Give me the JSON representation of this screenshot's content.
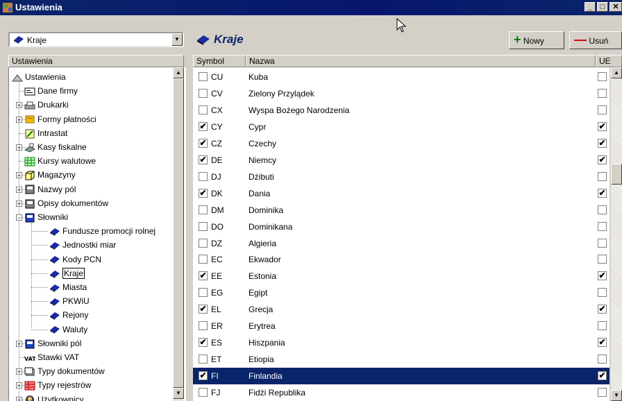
{
  "window": {
    "title": "Ustawienia",
    "controls": [
      "minimize",
      "maximize",
      "close"
    ]
  },
  "left": {
    "combo_value": "Kraje",
    "header": "Ustawienia",
    "tree": [
      {
        "label": "Ustawienia",
        "level": 0,
        "icon": "settings-icon",
        "expander": ""
      },
      {
        "label": "Dane firmy",
        "level": 1,
        "icon": "company-card-icon",
        "expander": ""
      },
      {
        "label": "Drukarki",
        "level": 1,
        "icon": "printer-icon",
        "expander": "+"
      },
      {
        "label": "Formy płatności",
        "level": 1,
        "icon": "payment-icon",
        "expander": "+"
      },
      {
        "label": "Intrastat",
        "level": 1,
        "icon": "intrastat-icon",
        "expander": ""
      },
      {
        "label": "Kasy fiskalne",
        "level": 1,
        "icon": "cash-register-icon",
        "expander": "+"
      },
      {
        "label": "Kursy walutowe",
        "level": 1,
        "icon": "currency-table-icon",
        "expander": ""
      },
      {
        "label": "Magazyny",
        "level": 1,
        "icon": "warehouse-icon",
        "expander": "+"
      },
      {
        "label": "Nazwy pól",
        "level": 1,
        "icon": "field-names-icon",
        "expander": "+"
      },
      {
        "label": "Opisy dokumentów",
        "level": 1,
        "icon": "document-desc-icon",
        "expander": "+"
      },
      {
        "label": "Słowniki",
        "level": 1,
        "icon": "dictionary-icon",
        "expander": "−"
      },
      {
        "label": "Fundusze promocji rolnej",
        "level": 2,
        "icon": "book-icon",
        "expander": ""
      },
      {
        "label": "Jednostki miar",
        "level": 2,
        "icon": "book-icon",
        "expander": ""
      },
      {
        "label": "Kody PCN",
        "level": 2,
        "icon": "book-icon",
        "expander": ""
      },
      {
        "label": "Kraje",
        "level": 2,
        "icon": "book-icon",
        "expander": "",
        "selected": true
      },
      {
        "label": "Miasta",
        "level": 2,
        "icon": "book-icon",
        "expander": ""
      },
      {
        "label": "PKWiU",
        "level": 2,
        "icon": "book-icon",
        "expander": ""
      },
      {
        "label": "Rejony",
        "level": 2,
        "icon": "book-icon",
        "expander": ""
      },
      {
        "label": "Waluty",
        "level": 2,
        "icon": "book-icon",
        "expander": ""
      },
      {
        "label": "Słowniki pól",
        "level": 1,
        "icon": "dictionary-icon",
        "expander": "+"
      },
      {
        "label": "Stawki VAT",
        "level": 1,
        "icon": "vat-icon",
        "expander": ""
      },
      {
        "label": "Typy dokumentów",
        "level": 1,
        "icon": "document-types-icon",
        "expander": "+"
      },
      {
        "label": "Typy rejestrów",
        "level": 1,
        "icon": "register-types-icon",
        "expander": "+"
      },
      {
        "label": "Użytkownicy",
        "level": 1,
        "icon": "users-icon",
        "expander": "+"
      }
    ]
  },
  "right": {
    "title": "Kraje",
    "new_label": "Nowy",
    "delete_label": "Usuń",
    "columns": {
      "symbol": "Symbol",
      "name": "Nazwa",
      "eu": "UE"
    },
    "rows": [
      {
        "sym": "CU",
        "name": "Kuba",
        "checked": false,
        "eu": false
      },
      {
        "sym": "CV",
        "name": "Zielony Przylądek",
        "checked": false,
        "eu": false
      },
      {
        "sym": "CX",
        "name": "Wyspa Bożego Narodzenia",
        "checked": false,
        "eu": false
      },
      {
        "sym": "CY",
        "name": "Cypr",
        "checked": true,
        "eu": true
      },
      {
        "sym": "CZ",
        "name": "Czechy",
        "checked": true,
        "eu": true
      },
      {
        "sym": "DE",
        "name": "Niemcy",
        "checked": true,
        "eu": true
      },
      {
        "sym": "DJ",
        "name": "Dżibuti",
        "checked": false,
        "eu": false
      },
      {
        "sym": "DK",
        "name": "Dania",
        "checked": true,
        "eu": true
      },
      {
        "sym": "DM",
        "name": "Dominika",
        "checked": false,
        "eu": false
      },
      {
        "sym": "DO",
        "name": "Dominikana",
        "checked": false,
        "eu": false
      },
      {
        "sym": "DZ",
        "name": "Algieria",
        "checked": false,
        "eu": false
      },
      {
        "sym": "EC",
        "name": "Ekwador",
        "checked": false,
        "eu": false
      },
      {
        "sym": "EE",
        "name": "Estonia",
        "checked": true,
        "eu": true
      },
      {
        "sym": "EG",
        "name": "Egipt",
        "checked": false,
        "eu": false
      },
      {
        "sym": "EL",
        "name": "Grecja",
        "checked": true,
        "eu": true
      },
      {
        "sym": "ER",
        "name": "Erytrea",
        "checked": false,
        "eu": false
      },
      {
        "sym": "ES",
        "name": "Hiszpania",
        "checked": true,
        "eu": true
      },
      {
        "sym": "ET",
        "name": "Etiopia",
        "checked": false,
        "eu": false
      },
      {
        "sym": "FI",
        "name": "Finlandia",
        "checked": true,
        "eu": true,
        "selected": true
      },
      {
        "sym": "FJ",
        "name": "Fidżi Republika",
        "checked": false,
        "eu": false
      }
    ]
  },
  "colors": {
    "titlebar": "#0a246a",
    "selection": "#0a246a",
    "new_icon": "#008000",
    "delete_icon": "#cc0000"
  }
}
